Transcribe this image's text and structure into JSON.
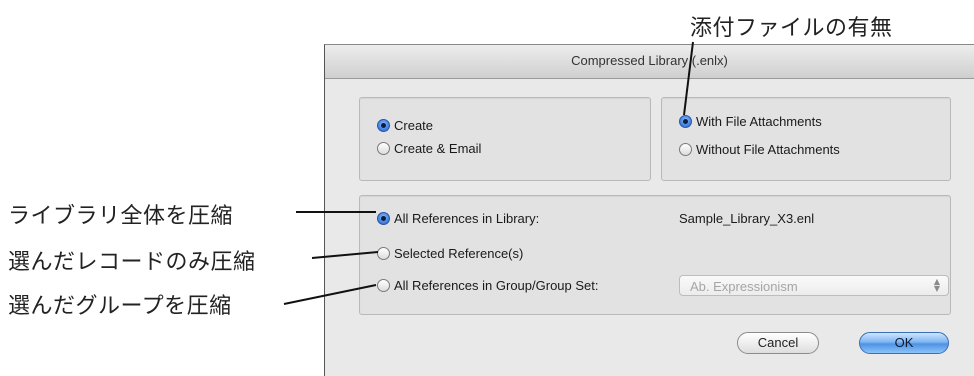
{
  "annotations": {
    "attachments_label": "添付ファイルの有無",
    "compress_all_label": "ライブラリ全体を圧縮",
    "compress_selected_label": "選んだレコードのみ圧縮",
    "compress_group_label": "選んだグループを圧縮"
  },
  "dialog": {
    "title": "Compressed Library (.enlx)",
    "action_options": [
      "Create",
      "Create & Email"
    ],
    "action_selected": "Create",
    "attachment_options": [
      "With File Attachments",
      "Without File Attachments"
    ],
    "attachment_selected": "With File Attachments",
    "reference_options": [
      "All References in Library:",
      "Selected Reference(s)",
      "All References in Group/Group Set:"
    ],
    "reference_selected": "All References in Library:",
    "library_name": "Sample_Library_X3.enl",
    "group_popup_value": "Ab. Expressionism",
    "cancel_label": "Cancel",
    "ok_label": "OK"
  },
  "colors": {
    "dialog_bg": "#e9e9e9",
    "radio_selected": "#3b79d8",
    "ok_button": "#4f92e3"
  }
}
